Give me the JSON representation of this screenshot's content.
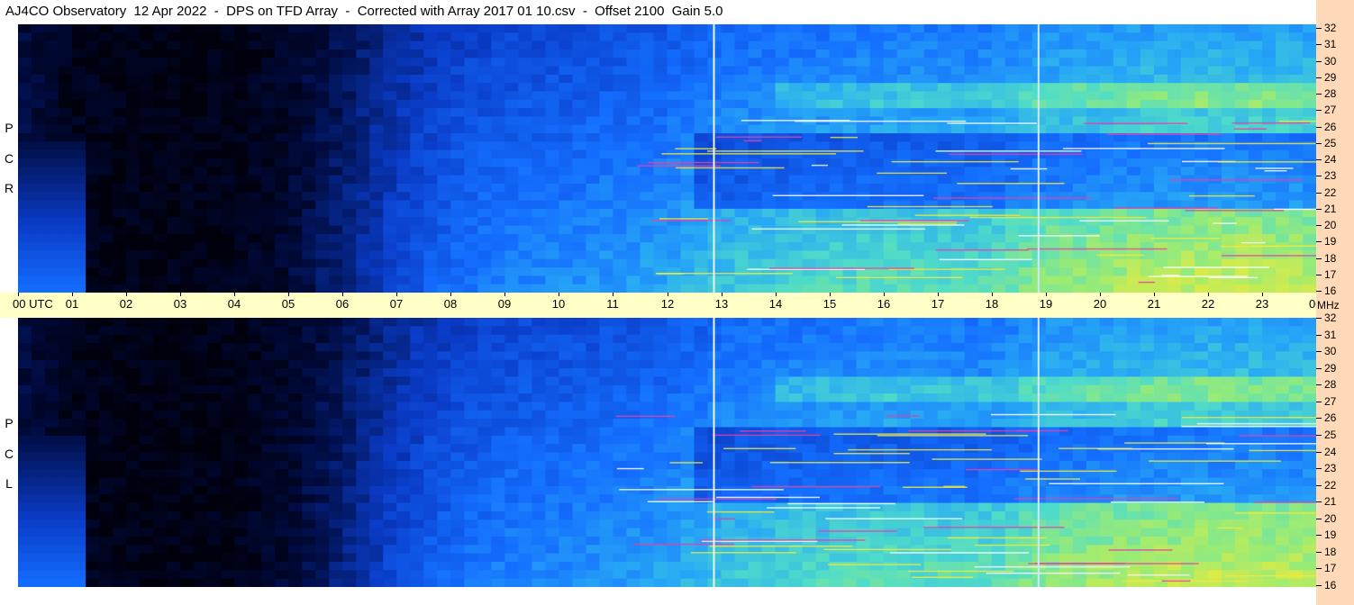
{
  "title": "AJ4CO Observatory  12 Apr 2022  -  DPS on TFD Array  -  Corrected with Array 2017 01 10.csv  -  Offset 2100  Gain 5.0",
  "polarization": {
    "top": [
      "R",
      "C",
      "P"
    ],
    "bottom": [
      "L",
      "C",
      "P"
    ]
  },
  "time_axis": {
    "start_label": "00 UTC",
    "labels": [
      "01",
      "02",
      "03",
      "04",
      "05",
      "06",
      "07",
      "08",
      "09",
      "10",
      "11",
      "12",
      "13",
      "14",
      "15",
      "16",
      "17",
      "18",
      "19",
      "20",
      "21",
      "22",
      "23"
    ],
    "end_label": "00"
  },
  "freq_axis": {
    "labels_top": [
      "32",
      "31",
      "30",
      "29",
      "28",
      "27",
      "26",
      "25",
      "24",
      "23",
      "22",
      "21",
      "20",
      "19",
      "18",
      "17",
      "16"
    ],
    "labels_bottom": [
      "32",
      "31",
      "30",
      "29",
      "28",
      "27",
      "26",
      "25",
      "24",
      "23",
      "22",
      "21",
      "20",
      "19",
      "18",
      "17",
      "16"
    ],
    "unit": "MHz"
  },
  "colors": {
    "background_dark": "#000010",
    "mid_blue": "#1565ff",
    "light_blue": "#3aa0ff",
    "cyan": "#3fd8e8",
    "green": "#7fe89a",
    "yellow": "#f2ea3a",
    "magenta": "#e83fa8",
    "time_axis_bg": "#ffffc6",
    "freq_axis_bg": "#ffd9b8"
  },
  "chart_data": {
    "type": "heatmap",
    "title": "AJ4CO Observatory  12 Apr 2022  -  DPS on TFD Array  -  Corrected with Array 2017 01 10.csv  -  Offset 2100  Gain 5.0",
    "xlabel": "UTC",
    "ylabel": "MHz",
    "x_range_hours": [
      0,
      24
    ],
    "y_range_mhz": [
      16,
      32
    ],
    "panels": [
      "RCP",
      "LCP"
    ],
    "white_vertical_lines_utc": [
      12.85,
      18.85
    ],
    "intensity_profile_by_hour": {
      "hours": [
        0,
        1,
        2,
        3,
        4,
        5,
        6,
        7,
        8,
        9,
        10,
        11,
        12,
        13,
        14,
        15,
        16,
        17,
        18,
        19,
        20,
        21,
        22,
        23,
        24
      ],
      "relative_level": [
        0.15,
        0.05,
        0.02,
        0.02,
        0.03,
        0.08,
        0.2,
        0.35,
        0.45,
        0.5,
        0.52,
        0.55,
        0.58,
        0.65,
        0.68,
        0.7,
        0.72,
        0.72,
        0.72,
        0.8,
        0.82,
        0.85,
        0.86,
        0.86,
        0.85
      ]
    }
  }
}
